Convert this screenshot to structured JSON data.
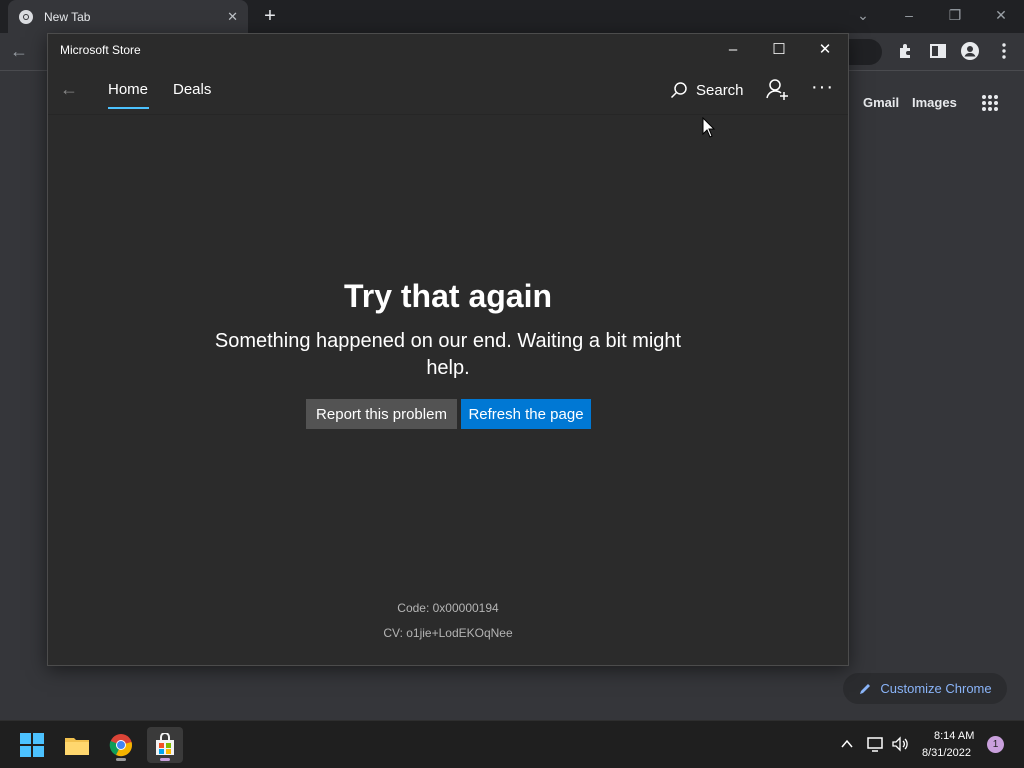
{
  "chrome": {
    "tab_title": "New Tab",
    "ntp_links": [
      "Gmail",
      "Images"
    ],
    "customize_label": "Customize Chrome"
  },
  "store": {
    "window_title": "Microsoft Store",
    "tabs": [
      "Home",
      "Deals"
    ],
    "search_label": "Search",
    "more_label": "···",
    "error_title": "Try that again",
    "error_message": "Something happened on our end. Waiting a bit might help.",
    "report_label": "Report this problem",
    "refresh_label": "Refresh the page",
    "code_text": "Code: 0x00000194",
    "cv_text": "CV: o1jie+LodEKOqNee"
  },
  "taskbar": {
    "time": "8:14 AM",
    "date": "8/31/2022",
    "notification_count": "1"
  },
  "colors": {
    "accent": "#0078d4",
    "tab_underline": "#4cc2ff",
    "chrome_link": "#8ab4f8"
  }
}
